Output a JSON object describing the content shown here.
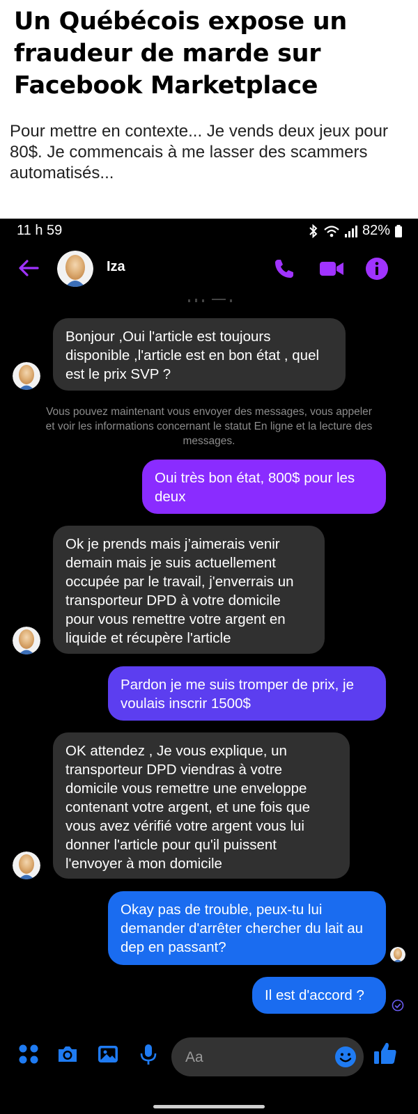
{
  "article": {
    "headline": "Un Québécois expose un fraudeur de marde sur Facebook Marketplace",
    "intro": "Pour mettre en contexte... Je vends deux jeux pour 80$. Je commencais à me lasser des scammers automatisés..."
  },
  "status_bar": {
    "time": "11 h 59",
    "battery": "82%",
    "icons": [
      "bluetooth-icon",
      "wifi-icon",
      "signal-icon",
      "battery-icon"
    ]
  },
  "header": {
    "contact_name": "Iza",
    "icons": [
      "back-arrow-icon",
      "phone-icon",
      "video-icon",
      "info-icon"
    ]
  },
  "messages": [
    {
      "sender": "contact",
      "text": "Bonjour ,Oui l'article est toujours disponible ,l'article  est en bon état , quel est le prix SVP ?"
    },
    {
      "sender": "me",
      "text": "Oui très bon état, 800$ pour les deux"
    },
    {
      "sender": "contact",
      "text": "Ok je prends mais j’aimerais venir demain mais je suis actuellement occupée par le travail, j'enverrais un transporteur  DPD  à votre domicile pour vous remettre votre argent en liquide et récupère l'article"
    },
    {
      "sender": "me",
      "text": "Pardon je me suis tromper de prix, je voulais inscrir 1500$"
    },
    {
      "sender": "contact",
      "text": "OK attendez , Je vous explique, un transporteur DPD viendras à votre domicile vous remettre une enveloppe contenant votre argent, et une fois que vous avez vérifié votre argent vous lui donner l'article pour qu'il puissent l'envoyer à mon domicile"
    },
    {
      "sender": "me",
      "text": "Okay pas de trouble, peux-tu lui demander d'arrêter chercher du lait au dep en passant?"
    },
    {
      "sender": "me",
      "text": "Il est d'accord ?"
    }
  ],
  "notice": "Vous pouvez maintenant vous envoyer des messages, vous appeler et voir les informations concernant le statut En ligne et la lecture des messages.",
  "composer": {
    "placeholder": "Aa",
    "icons": [
      "apps-icon",
      "camera-icon",
      "gallery-icon",
      "microphone-icon",
      "emoji-icon",
      "thumbs-up-icon"
    ]
  },
  "colors": {
    "accent": "#a033ff",
    "bubble_purple": "#8a2cff",
    "bubble_violet": "#5c3ef0",
    "bubble_blue": "#1a6cf0",
    "composer_blue": "#1f7bf2",
    "incoming_bubble": "#303030"
  }
}
